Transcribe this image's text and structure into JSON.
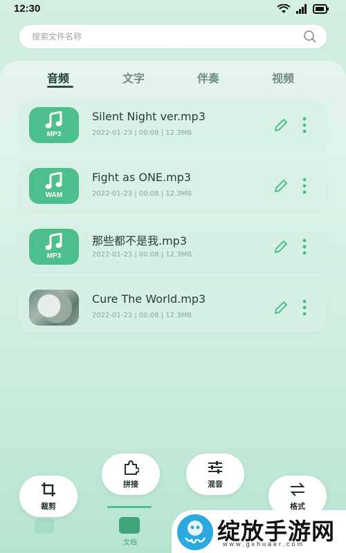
{
  "status": {
    "time": "12:30"
  },
  "search": {
    "placeholder": "搜索文件名称"
  },
  "tabs": [
    {
      "label": "音频",
      "active": true
    },
    {
      "label": "文字",
      "active": false
    },
    {
      "label": "伴奏",
      "active": false
    },
    {
      "label": "视频",
      "active": false
    }
  ],
  "files": [
    {
      "name": "Silent Night ver.mp3",
      "meta": "2022-01-23 | 00:08 | 12.3MB",
      "thumb": "MP3"
    },
    {
      "name": "Fight as ONE.mp3",
      "meta": "2022-01-23 | 00:08 | 12.3MB",
      "thumb": "WAM"
    },
    {
      "name": "那些都不是我.mp3",
      "meta": "2022-01-23 | 00:08 | 12.3MB",
      "thumb": "MP3"
    },
    {
      "name": "Cure The World.mp3",
      "meta": "2022-01-23 | 00:08 | 12.3MB",
      "thumb": "photo"
    }
  ],
  "actions": {
    "crop": "裁剪",
    "splice": "拼接",
    "mix": "混音",
    "format": "格式"
  },
  "nav": {
    "doc_label": "文档"
  },
  "watermark": {
    "text": "绽放手游网",
    "url": "www.gxhuaer.com"
  },
  "colors": {
    "accent": "#4dbf8d",
    "thumb_bg": "#4dbf8d"
  }
}
